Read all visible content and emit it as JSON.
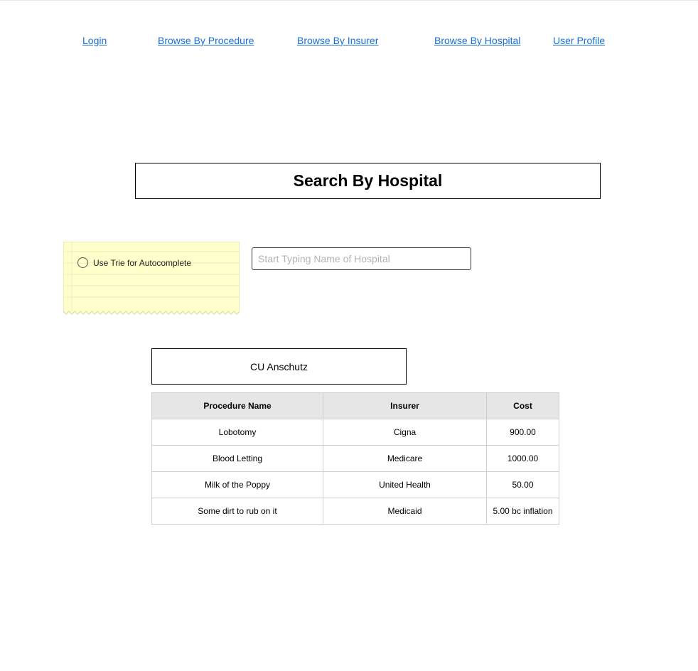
{
  "nav": {
    "login": "Login",
    "browse_procedure": "Browse By Procedure",
    "browse_insurer": "Browse By Insurer",
    "browse_hospital": "Browse By Hospital",
    "user_profile": "User Profile"
  },
  "page_title": "Search By Hospital",
  "sticky_note": {
    "radio_label": "Use Trie for Autocomplete",
    "radio_checked": false
  },
  "search": {
    "placeholder": "Start Typing Name of Hospital",
    "value": ""
  },
  "selected_hospital": "CU Anschutz",
  "table": {
    "headers": [
      "Procedure Name",
      "Insurer",
      "Cost"
    ],
    "rows": [
      [
        "Lobotomy",
        "Cigna",
        "900.00"
      ],
      [
        "Blood Letting",
        "Medicare",
        "1000.00"
      ],
      [
        "Milk of the Poppy",
        "United Health",
        "50.00"
      ],
      [
        "Some dirt to rub on it",
        "Medicaid",
        "5.00 bc inflation"
      ]
    ]
  },
  "colors": {
    "link": "#1a6fd6",
    "sticky_fill": "#ffffcc",
    "table_header_bg": "#e6e6e6"
  }
}
